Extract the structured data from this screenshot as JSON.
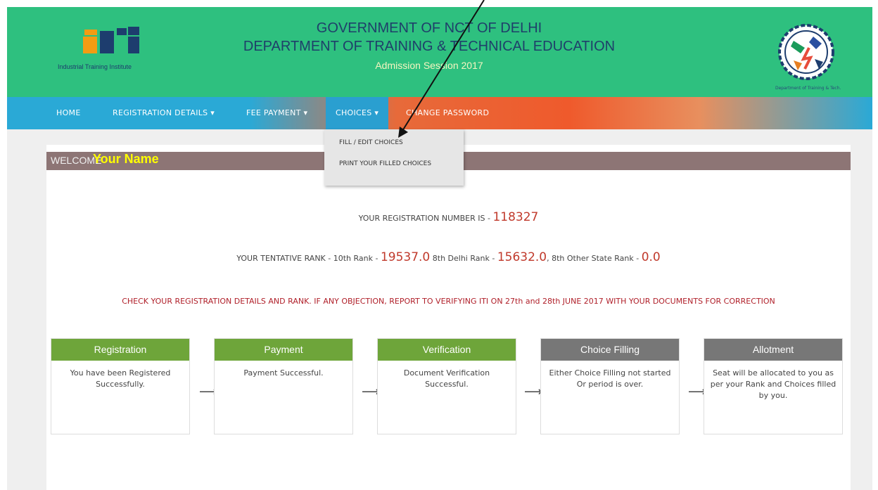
{
  "header": {
    "logo_caption": "Industrial Training Institute",
    "title_line1": "GOVERNMENT OF NCT OF DELHI",
    "title_line2": "DEPARTMENT OF TRAINING & TECHNICAL EDUCATION",
    "title_line3": "Admission Session 2017",
    "emblem_label": "Department of Training & Tech.",
    "colors": {
      "header_bg": "#2ec07f",
      "title": "#1f3f6a"
    }
  },
  "nav": {
    "items": [
      {
        "label": "HOME"
      },
      {
        "label": "REGISTRATION DETAILS ▾"
      },
      {
        "label": "FEE PAYMENT ▾"
      },
      {
        "label": "CHOICES ▾"
      },
      {
        "label": "CHANGE PASSWORD"
      }
    ],
    "active": "CHOICES ▾"
  },
  "dropdown": {
    "items": [
      {
        "label": "FILL / EDIT CHOICES"
      },
      {
        "label": "PRINT YOUR FILLED CHOICES"
      }
    ]
  },
  "welcome": {
    "label": "WELCOME",
    "name": "Your Name"
  },
  "registration": {
    "prefix": "YOUR REGISTRATION NUMBER IS - ",
    "number": "118327"
  },
  "rank": {
    "prefix": "YOUR TENTATIVE RANK - 10th Rank - ",
    "tenth": "19537.0",
    "eighth_delhi_label": " 8th Delhi Rank - ",
    "eighth_delhi": "15632.0",
    "eighth_other_label": ", 8th Other State Rank - ",
    "eighth_other": "0.0"
  },
  "warning": "CHECK YOUR REGISTRATION DETAILS AND RANK. IF ANY OBJECTION, REPORT TO VERIFYING ITI ON 27th and 28th JUNE 2017 WITH YOUR DOCUMENTS FOR CORRECTION",
  "steps": [
    {
      "title": "Registration",
      "body": "You have been Registered Successfully.",
      "status_color": "#6ea53a"
    },
    {
      "title": "Payment",
      "body": "Payment Successful.",
      "status_color": "#6ea53a"
    },
    {
      "title": "Verification",
      "body": "Document Verification Successful.",
      "status_color": "#6ea53a"
    },
    {
      "title": "Choice Filling",
      "body": "Either Choice Filling not started Or period is over.",
      "status_color": "#777777"
    },
    {
      "title": "Allotment",
      "body": "Seat will be allocated to you as per your Rank and Choices filled by you.",
      "status_color": "#777777"
    }
  ],
  "arrow_glyph": "⟶"
}
